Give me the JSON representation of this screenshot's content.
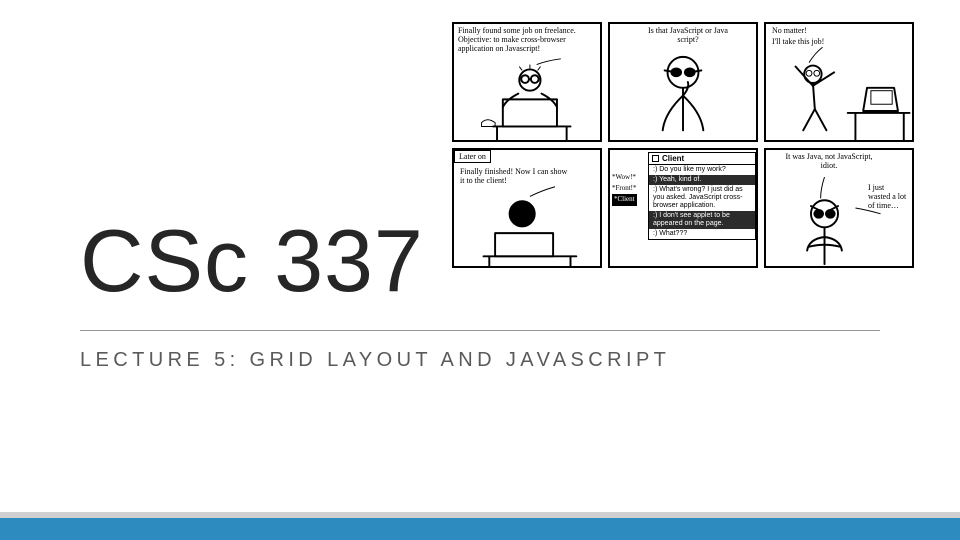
{
  "title": "CSc 337",
  "subtitle": "LECTURE 5: GRID LAYOUT AND JAVASCRIPT",
  "comic": {
    "panel1": "Finally found some job on freelance. Objective: to make cross-browser application on Javascript!",
    "panel2": "Is that JavaScript or Java script?",
    "panel3a": "No matter!",
    "panel3b": "I'll take this job!",
    "panel4_tag": "Later on",
    "panel4": "Finally finished! Now I can show it to the client!",
    "panel5": {
      "left1": "*Wow!*",
      "left2": "*Front!*",
      "left3": "*Client",
      "header": "Client",
      "l1": ":) Do you like my work?",
      "l2": ":) Yeah, kind of.",
      "l3": ":) What's wrong? I just did as you asked. JavaScript cross-browser application.",
      "l4": ":) I don't see applet to be appeared on the page.",
      "l5": ":) What???"
    },
    "panel6a": "It was Java, not JavaScript, idiot.",
    "panel6b": "I just wasted a lot of time…"
  }
}
